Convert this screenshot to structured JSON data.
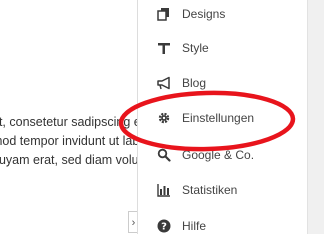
{
  "content": {
    "lines": [
      "et, consetetur sadipscing elitr, sed diam",
      "mod tempor invidunt ut labore et dolore",
      "quyam erat, sed diam voluptua."
    ]
  },
  "sidebar": {
    "items": [
      {
        "label": "Designs",
        "icon": "designs-icon"
      },
      {
        "label": "Style",
        "icon": "style-icon"
      },
      {
        "label": "Blog",
        "icon": "megaphone-icon"
      },
      {
        "label": "Einstellungen",
        "icon": "gear-icon"
      },
      {
        "label": "Google & Co.",
        "icon": "search-icon"
      },
      {
        "label": "Statistiken",
        "icon": "bar-chart-icon"
      },
      {
        "label": "Hilfe",
        "icon": "help-icon"
      }
    ]
  },
  "toggle": {
    "symbol": "›"
  },
  "colors": {
    "highlight": "#e8141c",
    "text": "#444444",
    "icon": "#3a3a3a"
  }
}
